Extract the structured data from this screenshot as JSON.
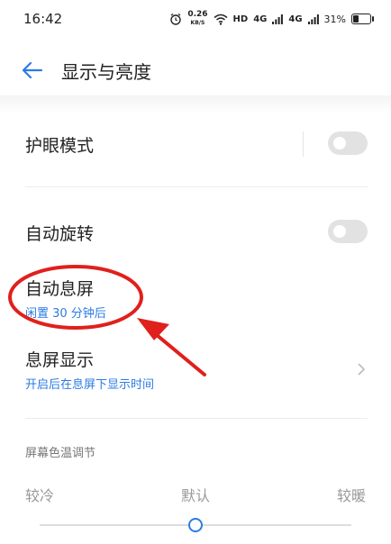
{
  "status_bar": {
    "time": "16:42",
    "net_speed_value": "0.26",
    "net_speed_unit": "KB/S",
    "hd_label": "HD",
    "sim1_label": "4G",
    "sim2_label": "4G",
    "battery_percent": "31%",
    "battery_level": 0.31
  },
  "header": {
    "title": "显示与亮度"
  },
  "settings": {
    "eye_care": {
      "label": "护眼模式",
      "enabled": false
    },
    "auto_rotate": {
      "label": "自动旋转",
      "enabled": false
    },
    "auto_sleep": {
      "label": "自动息屏",
      "value": "闲置 30 分钟后"
    },
    "aod": {
      "label": "息屏显示",
      "subtitle": "开启后在息屏下显示时间"
    }
  },
  "color_temperature": {
    "section_label": "屏幕色温调节",
    "cold_label": "较冷",
    "default_label": "默认",
    "warm_label": "较暖",
    "level": 0.5
  },
  "colors": {
    "accent": "#2a7be4",
    "annotation": "#e0201c"
  }
}
